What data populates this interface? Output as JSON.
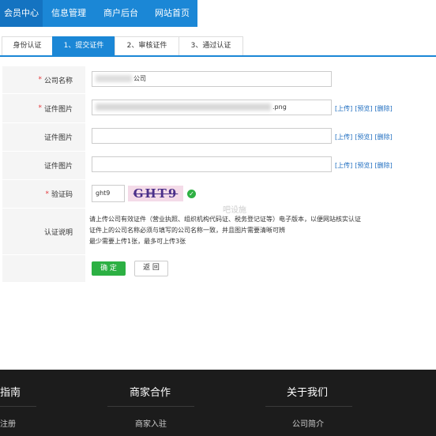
{
  "colors": {
    "primary": "#1b87d6",
    "nav_bg": "#1b87d6",
    "nav_active": "#1473c1",
    "success": "#2cb043",
    "footer_bg": "#1c1c1c"
  },
  "topnav": {
    "items": [
      {
        "label": "会员中心",
        "active": true
      },
      {
        "label": "信息管理",
        "active": false
      },
      {
        "label": "商户后台",
        "active": false
      },
      {
        "label": "网站首页",
        "active": false
      }
    ]
  },
  "tabs": [
    {
      "label": "身份认证",
      "active": false
    },
    {
      "label": "1、提交证件",
      "active": true
    },
    {
      "label": "2、审核证件",
      "active": false
    },
    {
      "label": "3、通过认证",
      "active": false
    }
  ],
  "form": {
    "company_label": "公司名称",
    "company_value_suffix": "公司",
    "cert_label": "证件图片",
    "cert1_value_suffix": ".png",
    "cert2_value": "",
    "cert3_value": "",
    "link_upload": "[上传]",
    "link_preview": "[预览]",
    "link_delete": "[删除]",
    "captcha_label": "验证码",
    "captcha_value": "ght9",
    "captcha_image_text": "GHT9",
    "desc_label": "认证说明",
    "desc_lines": [
      "请上传公司有效证件（营业执照、组织机构代码证、税务登记证等）电子版本，以便网站核实认证",
      "证件上的公司名称必须与填写的公司名称一致，并且图片需要清晰可辨",
      "最少需要上传1张，最多可上传3张"
    ],
    "submit_label": "确 定",
    "back_label": "返 回"
  },
  "watermark": "吧设施",
  "footer": {
    "col1_title": "指南",
    "col1_link": "注册",
    "col2_title": "商家合作",
    "col2_link": "商家入驻",
    "col3_title": "关于我们",
    "col3_link": "公司简介"
  }
}
